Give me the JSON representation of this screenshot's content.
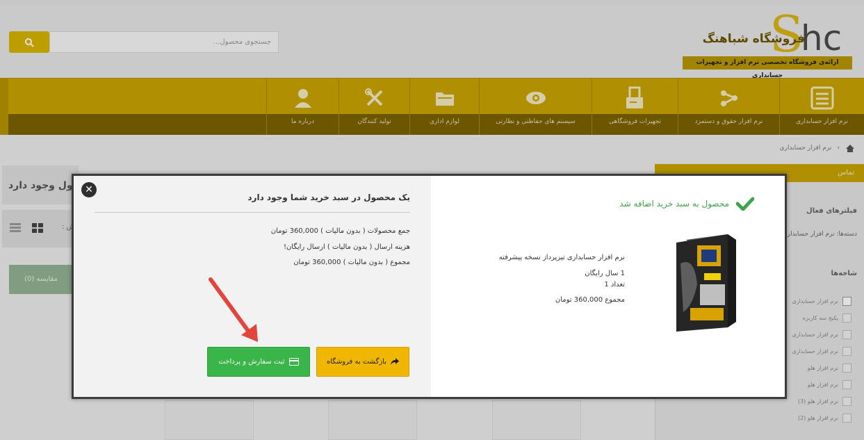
{
  "header": {
    "search_placeholder": "جستجوی محصول...",
    "logo_text": "فروشگاه شباهنگ",
    "logo_sub": "ارائه‌ی فروشگاه تخصصی نرم افزار و تجهیزات حسابداری"
  },
  "nav": {
    "items": [
      {
        "label": "نرم افزار حسابداری",
        "icon": "spreadsheet-icon"
      },
      {
        "label": "نرم افزار حقوق و دستمزد",
        "icon": "share-icon"
      },
      {
        "label": "تجهیزات فروشگاهی",
        "icon": "printer-icon"
      },
      {
        "label": "سیستم های حفاظتی و نظارتی",
        "icon": "eye-icon"
      },
      {
        "label": "لوازم اداری",
        "icon": "folder-icon"
      },
      {
        "label": "تولید کنندگان",
        "icon": "tools-icon"
      },
      {
        "label": "درباره ما",
        "icon": "user-icon"
      }
    ]
  },
  "breadcrumb": {
    "current": "نرم افزار حسابداری"
  },
  "sidebar": {
    "title": "تماس",
    "filters_heading": "فیلترهای فعال",
    "active_filter": "دسته‌ها: نرم افزار حسابداری",
    "brands_heading": "شاخه‌ها",
    "rows": [
      "نرم افزار حسابداری",
      "پکیج سه کاربره",
      "نرم افزار حسابداری",
      "نرم افزار حسابداری",
      "نرم افزار هلو",
      "نرم افزار هلو",
      "نرم افزار هلو (3)",
      "نرم افزار هلو (2)"
    ]
  },
  "page": {
    "title_partial": "ول وجود دارد",
    "compare_label": "مقایسه (0)",
    "sort_label": "ش :"
  },
  "modal": {
    "cart_title": "یک محصول در سبد خرید شما وجود دارد",
    "total_products": "جمع محصولات ( بدون مالیات ) 360,000 تومان",
    "shipping": "هزینه ارسال ( بدون مالیات ) ارسال رایگان!",
    "grand_total": "مجموع ( بدون مالیات ) 360,000 تومان",
    "back_button": "بازگشت به فروشگاه",
    "checkout_button": "ثبت سفارش و پرداخت",
    "added_message": "محصول به سبد خرید اضافه شد",
    "product_name": "نرم افزار حسابداری تیزپرداز نسخه پیشرفته",
    "product_attr": "1 سال رایگان",
    "product_qty": "تعداد 1",
    "product_total": "مجموع 360,000 تومان"
  },
  "colors": {
    "brand_gold": "#c9a300",
    "success_green": "#39b54a",
    "warning_yellow": "#f1b700",
    "arrow_red": "#e2453c"
  }
}
